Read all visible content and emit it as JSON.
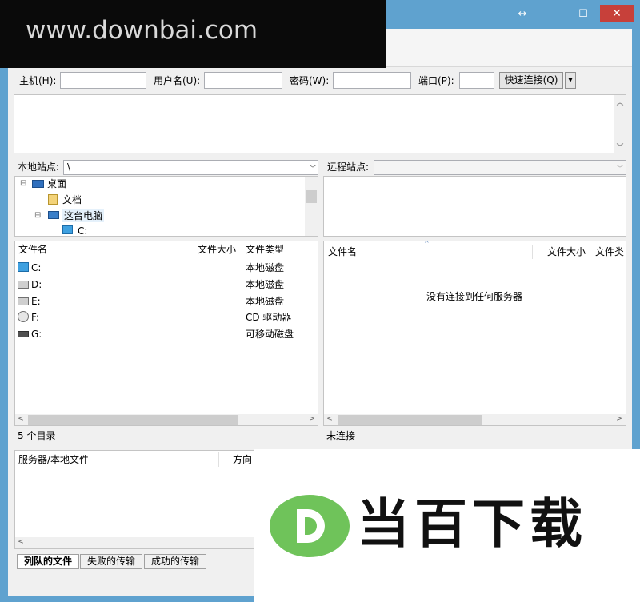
{
  "title_bar": {
    "restore_glyph": "↔",
    "minimize_glyph": "—",
    "maximize_glyph": "☐",
    "close_glyph": "✕"
  },
  "watermark": {
    "url_text": "www.downbai.com",
    "brand_text": "当百下载",
    "logo_letter": "D",
    "logo_color": "#6fc35a"
  },
  "quickconnect": {
    "host_label": "主机(H):",
    "user_label": "用户名(U):",
    "pass_label": "密码(W):",
    "port_label": "端口(P):",
    "host_value": "",
    "user_value": "",
    "pass_value": "",
    "port_value": "",
    "connect_button": "快速连接(Q)",
    "dropdown_glyph": "▾"
  },
  "local": {
    "site_label": "本地站点:",
    "path": "\\",
    "tree": [
      {
        "label": "桌面",
        "icon": "desktop-icon"
      },
      {
        "label": "文档",
        "icon": "documents-icon"
      },
      {
        "label": "这台电脑",
        "icon": "computer-icon"
      },
      {
        "label": "C:",
        "icon": "windows-drive-icon"
      }
    ],
    "columns": {
      "name": "文件名",
      "size": "文件大小",
      "type": "文件类型"
    },
    "rows": [
      {
        "name": "C:",
        "type": "本地磁盘",
        "icon": "windows-drive-icon"
      },
      {
        "name": "D:",
        "type": "本地磁盘",
        "icon": "hard-drive-icon"
      },
      {
        "name": "E:",
        "type": "本地磁盘",
        "icon": "hard-drive-icon"
      },
      {
        "name": "F:",
        "type": "CD 驱动器",
        "icon": "cd-drive-icon"
      },
      {
        "name": "G:",
        "type": "可移动磁盘",
        "icon": "removable-drive-icon"
      }
    ],
    "status": "5 个目录"
  },
  "remote": {
    "site_label": "远程站点:",
    "path": "",
    "columns": {
      "name": "文件名",
      "size": "文件大小",
      "type": "文件类"
    },
    "empty_message": "没有连接到任何服务器",
    "status": "未连接"
  },
  "queue": {
    "columns": {
      "server_file": "服务器/本地文件",
      "direction": "方向"
    },
    "tabs": [
      "列队的文件",
      "失败的传输",
      "成功的传输"
    ]
  },
  "colors": {
    "window_frame": "#5fa2cf",
    "close_button": "#c7403a",
    "accent_text": "#000000"
  }
}
